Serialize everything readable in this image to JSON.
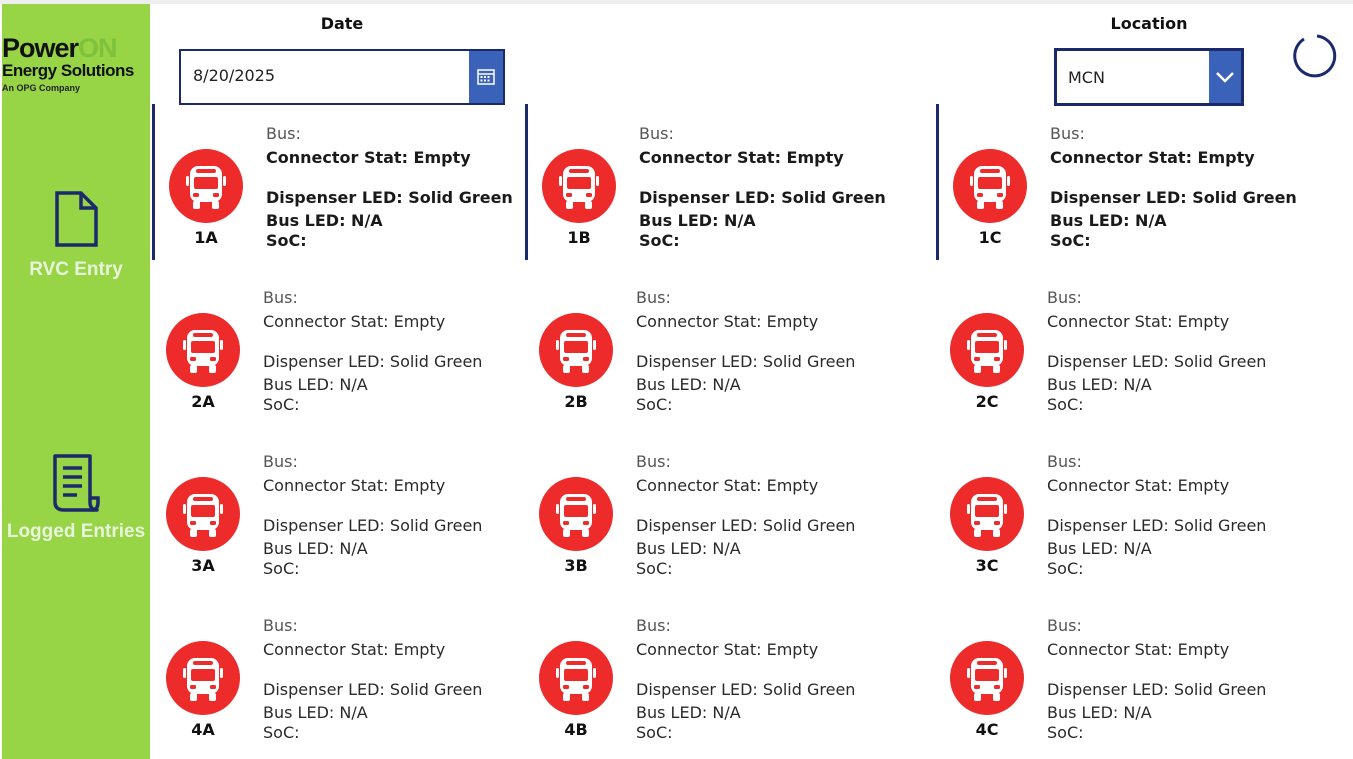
{
  "brand": {
    "name_part1": "Power",
    "name_part2": "ON",
    "subtitle": "Energy Solutions",
    "tagline": "An OPG Company"
  },
  "nav": [
    {
      "label": "RVC Entry",
      "icon": "document-icon"
    },
    {
      "label": "Logged Entries",
      "icon": "log-list-icon"
    }
  ],
  "header": {
    "date_label": "Date",
    "date_value": "8/20/2025",
    "location_label": "Location",
    "location_value": "MCN"
  },
  "field_labels": {
    "bus": "Bus:",
    "connector": "Connector Stat: ",
    "dispenser": "Dispenser LED: ",
    "bus_led": "Bus LED: ",
    "soc": "SoC:"
  },
  "colors": {
    "sidebar": "#97d547",
    "accent_blue": "#3a62b8",
    "border_navy": "#1b2a6b",
    "bus_red": "#ee2b2b"
  },
  "slots": [
    {
      "id": "1A",
      "bus": "",
      "connector": "Empty",
      "dispenser": "Solid Green",
      "bus_led": "N/A",
      "soc": "",
      "selected": true
    },
    {
      "id": "1B",
      "bus": "",
      "connector": "Empty",
      "dispenser": "Solid Green",
      "bus_led": "N/A",
      "soc": "",
      "selected": true
    },
    {
      "id": "1C",
      "bus": "",
      "connector": "Empty",
      "dispenser": "Solid Green",
      "bus_led": "N/A",
      "soc": "",
      "selected": true
    },
    {
      "id": "2A",
      "bus": "",
      "connector": "Empty",
      "dispenser": "Solid Green",
      "bus_led": "N/A",
      "soc": "",
      "selected": false
    },
    {
      "id": "2B",
      "bus": "",
      "connector": "Empty",
      "dispenser": "Solid Green",
      "bus_led": "N/A",
      "soc": "",
      "selected": false
    },
    {
      "id": "2C",
      "bus": "",
      "connector": "Empty",
      "dispenser": "Solid Green",
      "bus_led": "N/A",
      "soc": "",
      "selected": false
    },
    {
      "id": "3A",
      "bus": "",
      "connector": "Empty",
      "dispenser": "Solid Green",
      "bus_led": "N/A",
      "soc": "",
      "selected": false
    },
    {
      "id": "3B",
      "bus": "",
      "connector": "Empty",
      "dispenser": "Solid Green",
      "bus_led": "N/A",
      "soc": "",
      "selected": false
    },
    {
      "id": "3C",
      "bus": "",
      "connector": "Empty",
      "dispenser": "Solid Green",
      "bus_led": "N/A",
      "soc": "",
      "selected": false
    },
    {
      "id": "4A",
      "bus": "",
      "connector": "Empty",
      "dispenser": "Solid Green",
      "bus_led": "N/A",
      "soc": "",
      "selected": false
    },
    {
      "id": "4B",
      "bus": "",
      "connector": "Empty",
      "dispenser": "Solid Green",
      "bus_led": "N/A",
      "soc": "",
      "selected": false
    },
    {
      "id": "4C",
      "bus": "",
      "connector": "Empty",
      "dispenser": "Solid Green",
      "bus_led": "N/A",
      "soc": "",
      "selected": false
    }
  ]
}
